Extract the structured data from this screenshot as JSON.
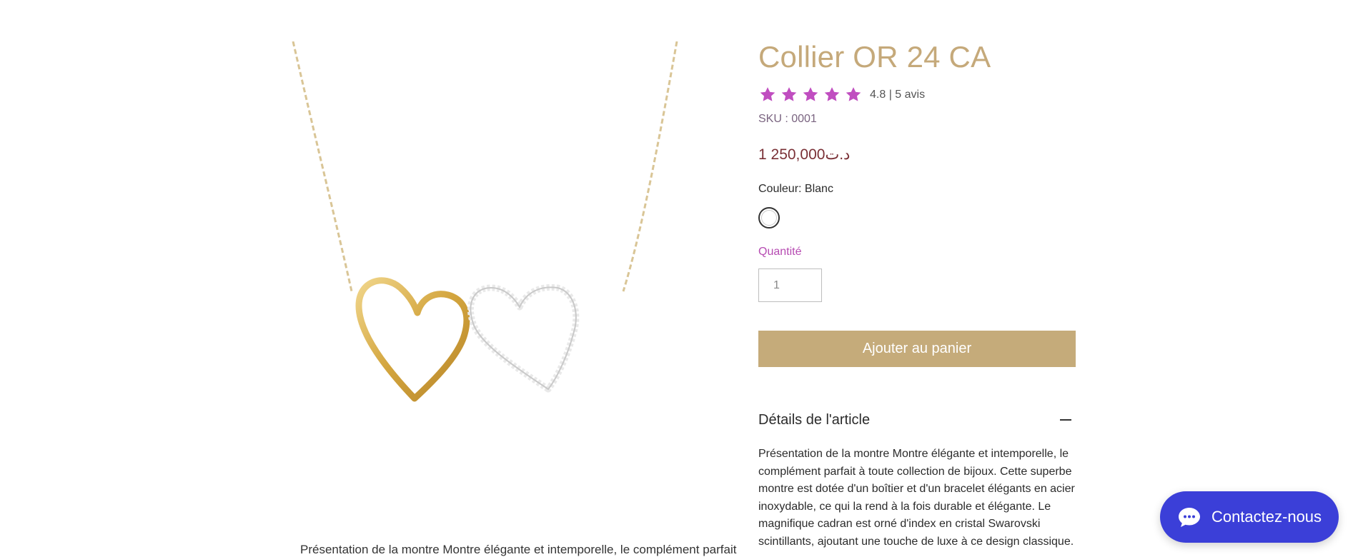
{
  "product": {
    "title": "Collier OR 24 CA",
    "rating_text": "4.8 | 5 avis",
    "sku": "SKU : 0001",
    "price": "1 250,000د.ت",
    "color_label": "Couleur: Blanc",
    "quantity_label": "Quantité",
    "quantity_value": "1",
    "add_to_cart": "Ajouter au panier",
    "details_title": "Détails de l'article",
    "details_text": "Présentation de la montre Montre élégante et intemporelle, le complément parfait à toute collection de bijoux. Cette superbe montre est dotée d'un boîtier et d'un bracelet élégants en acier inoxydable, ce qui la rend à la fois durable et élégante. Le magnifique cadran est orné d'index en cristal Swarovski scintillants, ajoutant une touche de luxe à ce design classique.",
    "description_caption": "Présentation de la montre Montre élégante et intemporelle, le complément parfait",
    "star_color": "#c04ec0",
    "star_count": 5,
    "rating_value": 4.8,
    "swatch_color": "#ffffff",
    "image_icon": "gold-silver-double-heart-necklace"
  },
  "chat": {
    "label": "Contactez-nous",
    "icon": "chat-bubble-icon",
    "color": "#3b3fd8"
  },
  "colors": {
    "title": "#c5a97a",
    "button": "#c5ab7a",
    "price": "#7a3036",
    "quantity_label": "#b64bb2"
  }
}
